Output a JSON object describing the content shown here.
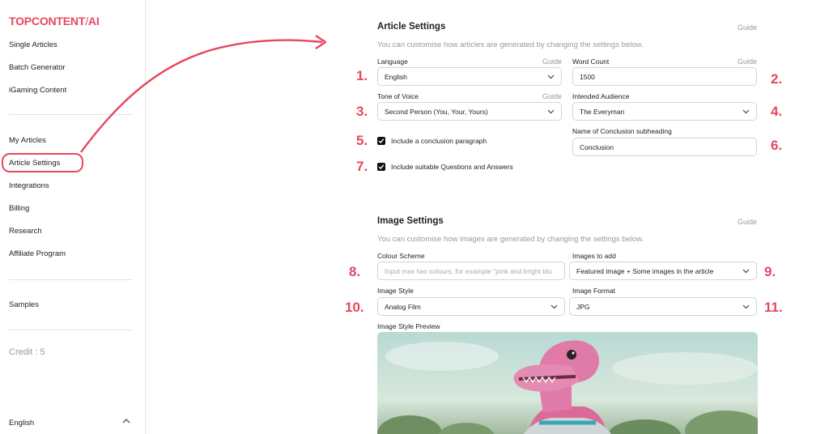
{
  "sidebar": {
    "logo_main": "TOPCONTENT",
    "logo_sep": "/",
    "logo_ai": "AI",
    "items": [
      {
        "label": "Single Articles"
      },
      {
        "label": "Batch Generator"
      },
      {
        "label": "iGaming Content"
      },
      {
        "label": "My Articles"
      },
      {
        "label": "Article Settings"
      },
      {
        "label": "Integrations"
      },
      {
        "label": "Billing"
      },
      {
        "label": "Research"
      },
      {
        "label": "Affiliate Program"
      },
      {
        "label": "Samples"
      }
    ],
    "credit": "Credit : 5",
    "language": "English"
  },
  "article_settings": {
    "title": "Article Settings",
    "guide": "Guide",
    "subtitle": "You can customise how articles are generated by changing the settings below.",
    "language_label": "Language",
    "language_guide": "Guide",
    "language_value": "English",
    "word_count_label": "Word Count",
    "word_count_guide": "Guide",
    "word_count_value": "1500",
    "tone_label": "Tone of Voice",
    "tone_guide": "Guide",
    "tone_value": "Second Person (You, Your, Yours)",
    "audience_label": "Intended Audience",
    "audience_value": "The Everyman",
    "conclusion_checkbox": "Include a conclusion paragraph",
    "conclusion_checked": true,
    "conclusion_subheading_label": "Name of Conclusion subheading",
    "conclusion_subheading_value": "Conclusion",
    "qa_checkbox": "Include suitable Questions and Answers",
    "qa_checked": true
  },
  "image_settings": {
    "title": "Image Settings",
    "guide": "Guide",
    "subtitle": "You can customise how images are generated by changing the settings below.",
    "colour_label": "Colour Scheme",
    "colour_placeholder": "Input max two colours, for example \"pink and bright blu",
    "images_add_label": "Images to add",
    "images_add_value": "Featured image + Some images in the article",
    "style_label": "Image Style",
    "style_value": "Analog Film",
    "format_label": "Image Format",
    "format_value": "JPG",
    "preview_label": "Image Style Preview"
  },
  "annotations": [
    "1.",
    "2.",
    "3.",
    "4.",
    "5.",
    "6.",
    "7.",
    "8.",
    "9.",
    "10.",
    "11."
  ],
  "colors": {
    "accent": "#e8475f",
    "muted": "#9a9a9a",
    "border": "#d4d4d4"
  }
}
